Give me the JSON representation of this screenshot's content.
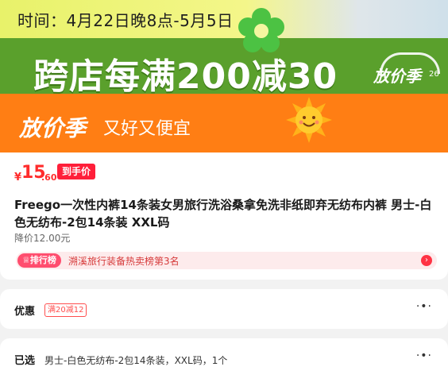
{
  "banner": {
    "time": "时间：4月22日晚8点-5月5日",
    "promo": "跨店每满200减30",
    "brand": "放价季",
    "slide_num": "26"
  },
  "strip": {
    "title": "放价季",
    "slogan": "又好又便宜"
  },
  "product": {
    "price_symbol": "¥",
    "price_integer": "15",
    "price_decimal": ".60",
    "price_tag": "到手价",
    "title": "Freego一次性内裤14条装女男旅行洗浴桑拿免洗非纸即弃无纺布内裤 男士-白色无纺布-2包14条装 XXL码",
    "original_price": "降价12.00元",
    "rank_badge": "排行榜",
    "rank_text": "溯溪旅行装备热卖榜第3名"
  },
  "discount": {
    "label": "优惠",
    "coupon": "满20减12",
    "more": "·•·"
  },
  "selected": {
    "label": "已选",
    "value": "男士-白色无纺布-2包14条装，XXL码，1个",
    "more": "·•·"
  },
  "colors": {
    "green": "#5aa02c",
    "orange": "#ff7e14",
    "price_red": "#ff2c2c"
  }
}
